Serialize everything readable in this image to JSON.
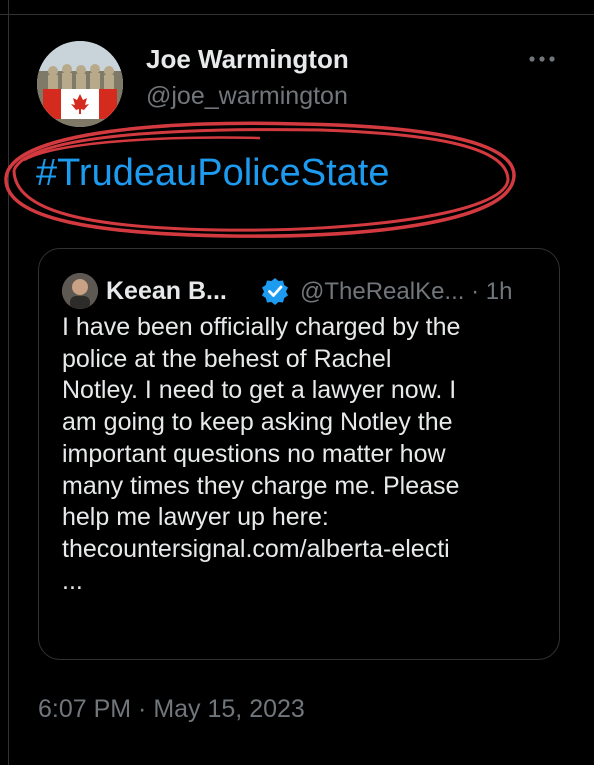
{
  "tweet": {
    "author_name": "Joe Warmington",
    "author_handle": "@joe_warmington",
    "hashtag": "#TrudeauPoliceState",
    "timestamp": "6:07 PM · May 15, 2023"
  },
  "quote": {
    "author_name": "Keean B...",
    "author_handle": "@TheRealKe... · 1h",
    "body_lines": [
      "I have been officially charged by the",
      "police at the behest of Rachel",
      "Notley. I need to get a lawyer now. I",
      "am going to keep asking Notley the",
      "important questions no matter how",
      "many times they charge me. Please",
      "help me lawyer up here:",
      "thecountersignal.com/alberta-electi",
      "..."
    ]
  },
  "icons": {
    "more": "more-dots-icon",
    "verified": "verified-badge-icon"
  },
  "colors": {
    "background": "#000000",
    "text": "#e7e9ea",
    "secondary_text": "#71767b",
    "link": "#1d9bf0",
    "verified": "#1d9bf0",
    "annotation_circle": "#d33a3f",
    "border": "#2f3336"
  }
}
